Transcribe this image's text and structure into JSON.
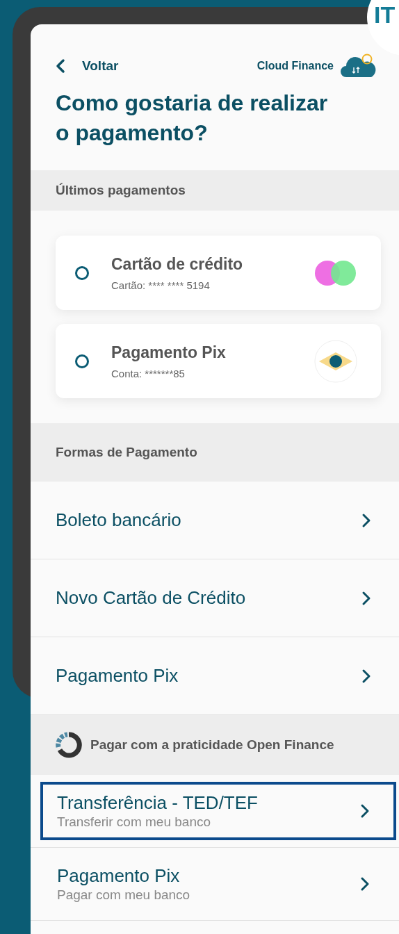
{
  "corner_badge": {
    "label": "IT"
  },
  "header": {
    "back_label": "Voltar",
    "brand": "Cloud Finance",
    "title": "Como gostaria de realizar o pagamento?"
  },
  "recent": {
    "heading": "Últimos pagamentos",
    "items": [
      {
        "kind": "card",
        "title": "Cartão de crédito",
        "subtitle": "Cartão: **** **** 5194",
        "selected": false
      },
      {
        "kind": "pix",
        "title": "Pagamento Pix",
        "subtitle": "Conta: *******85",
        "selected": false
      }
    ]
  },
  "methods": {
    "heading": "Formas de Pagamento",
    "items": [
      {
        "label": "Boleto bancário"
      },
      {
        "label": "Novo Cartão de Crédito"
      },
      {
        "label": "Pagamento Pix"
      }
    ]
  },
  "open_finance": {
    "heading": "Pagar com a praticidade Open Finance",
    "items": [
      {
        "label": "Transferência - TED/TEF",
        "subtitle": "Transferir com meu banco",
        "selected": true
      },
      {
        "label": "Pagamento Pix",
        "subtitle": "Pagar com meu banco",
        "selected": false
      }
    ]
  }
}
